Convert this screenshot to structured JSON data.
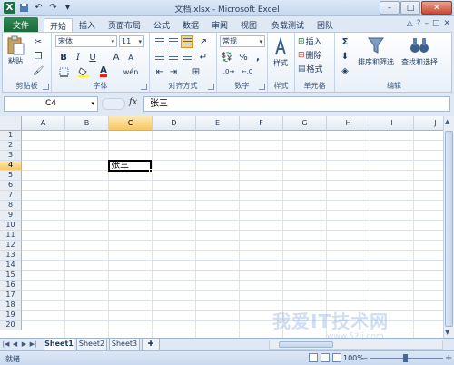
{
  "window": {
    "title": "文档.xlsx - Microsoft Excel"
  },
  "tabs": {
    "file": "文件",
    "items": [
      "开始",
      "插入",
      "页面布局",
      "公式",
      "数据",
      "审阅",
      "视图",
      "负载测试",
      "团队"
    ],
    "active": "开始"
  },
  "ribbon": {
    "clipboard": {
      "label": "剪贴板",
      "paste": "粘贴"
    },
    "font": {
      "label": "字体",
      "name": "宋体",
      "size": "11",
      "bold": "B",
      "italic": "I",
      "underline": "U",
      "grow": "A",
      "shrink": "A",
      "color_letter": "A",
      "phonetic": "wén"
    },
    "alignment": {
      "label": "对齐方式"
    },
    "number": {
      "label": "数字",
      "format": "常规",
      "percent": "%",
      "comma": ","
    },
    "styles": {
      "label": "样式",
      "button": "样式"
    },
    "cells": {
      "label": "单元格",
      "insert": "插入",
      "delete": "删除",
      "format": "格式"
    },
    "editing": {
      "label": "编辑",
      "sum": "Σ",
      "sort": "排序和筛选",
      "find": "查找和选择"
    }
  },
  "formula_bar": {
    "name_box": "C4",
    "fx": "fx",
    "content": "张三"
  },
  "grid": {
    "columns": [
      "A",
      "B",
      "C",
      "D",
      "E",
      "F",
      "G",
      "H",
      "I",
      "J"
    ],
    "rows": [
      "1",
      "2",
      "3",
      "4",
      "5",
      "6",
      "7",
      "8",
      "9",
      "10",
      "11",
      "12",
      "13",
      "14",
      "15",
      "16",
      "17",
      "18",
      "19",
      "20"
    ],
    "selected_column": "C",
    "selected_row": "4",
    "active_cell_value": "张三"
  },
  "sheets": {
    "tabs": [
      "Sheet1",
      "Sheet2",
      "Sheet3"
    ],
    "active": "Sheet1"
  },
  "status": {
    "text": "就绪",
    "zoom": "100%"
  },
  "watermark": {
    "text": "我爱IT技术网",
    "url": "www.52ij.com"
  },
  "colors": {
    "file_tab": "#1e7145",
    "accent": "#dfe9f5",
    "selection_header": "#f7c763"
  }
}
